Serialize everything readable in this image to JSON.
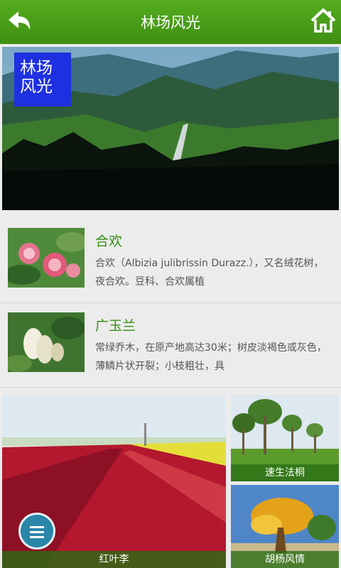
{
  "header": {
    "title": "林场风光",
    "back_icon": "back-arrow-icon",
    "home_icon": "home-icon"
  },
  "hero": {
    "badge_line1": "林场",
    "badge_line2": "风光"
  },
  "list": [
    {
      "title": "合欢",
      "desc": "合欢（Albizia julibrissin Durazz.），又名绒花树，夜合欢。豆科、合欢属植"
    },
    {
      "title": "广玉兰",
      "desc": "常绿乔木，在原产地高达30米；树皮淡褐色或灰色，薄鳞片状开裂；小枝粗壮，具"
    }
  ],
  "tiles": {
    "left": "红叶李",
    "right_top": "速生法桐",
    "right_bottom": "胡杨风情"
  },
  "menu_icon": "menu-icon",
  "colors": {
    "header": "#4a9f17",
    "accent_text": "#2f8f11",
    "badge": "#1e30df",
    "menu": "#2a86a8"
  }
}
